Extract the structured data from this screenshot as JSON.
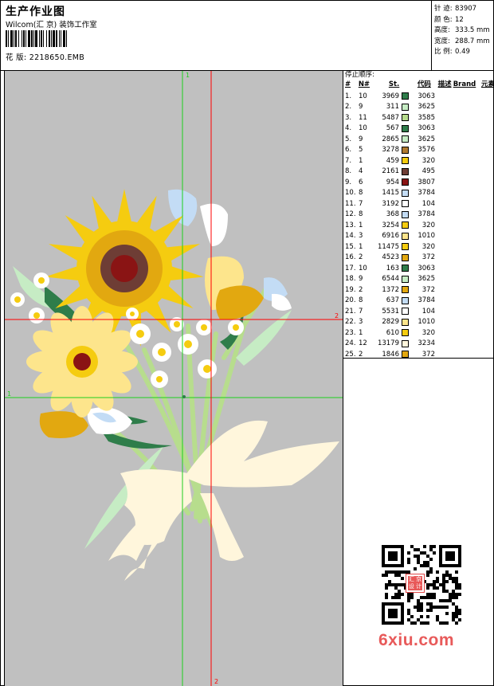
{
  "header": {
    "title": "生产作业图",
    "company": "Wilcom(汇 京) 装饰工作室",
    "design_label": "花 版: ",
    "design_file": "2218650.EMB"
  },
  "stats": [
    {
      "label": "针 迹:",
      "value": "83907"
    },
    {
      "label": "颜 色:",
      "value": "12"
    },
    {
      "label": "高度:",
      "value": "333.5 mm"
    },
    {
      "label": "宽度:",
      "value": "288.7 mm"
    },
    {
      "label": "比 例:",
      "value": "0.49"
    }
  ],
  "guides": {
    "red_vertical_label": "2",
    "red_horizontal_label": "2",
    "green_vertical_label": "1",
    "green_horizontal_label": "1"
  },
  "stop_sequence": {
    "title": "停止顺序:",
    "headers": {
      "idx": "#",
      "n": "N#",
      "st": "St.",
      "code": "代码",
      "desc": "描述",
      "brand": "Brand",
      "element": "元素"
    },
    "rows": [
      {
        "idx": "1.",
        "n": "10",
        "st": "3969",
        "code": "3063",
        "color": "#2f7d4a"
      },
      {
        "idx": "2.",
        "n": "9",
        "st": "311",
        "code": "3625",
        "color": "#c6ecc4"
      },
      {
        "idx": "3.",
        "n": "11",
        "st": "5487",
        "code": "3585",
        "color": "#b7dd8d"
      },
      {
        "idx": "4.",
        "n": "10",
        "st": "567",
        "code": "3063",
        "color": "#2f7d4a"
      },
      {
        "idx": "5.",
        "n": "9",
        "st": "2865",
        "code": "3625",
        "color": "#c6ecc4"
      },
      {
        "idx": "6.",
        "n": "5",
        "st": "3278",
        "code": "3576",
        "color": "#b07a30"
      },
      {
        "idx": "7.",
        "n": "1",
        "st": "459",
        "code": "320",
        "color": "#f5cc10"
      },
      {
        "idx": "8.",
        "n": "4",
        "st": "2161",
        "code": "495",
        "color": "#6e3d35"
      },
      {
        "idx": "9.",
        "n": "6",
        "st": "954",
        "code": "3807",
        "color": "#8a1414"
      },
      {
        "idx": "10.",
        "n": "8",
        "st": "1415",
        "code": "3784",
        "color": "#c3dcf5"
      },
      {
        "idx": "11.",
        "n": "7",
        "st": "3192",
        "code": "104",
        "color": "#ffffff"
      },
      {
        "idx": "12.",
        "n": "8",
        "st": "368",
        "code": "3784",
        "color": "#c3dcf5"
      },
      {
        "idx": "13.",
        "n": "1",
        "st": "3254",
        "code": "320",
        "color": "#f5cc10"
      },
      {
        "idx": "14.",
        "n": "3",
        "st": "6916",
        "code": "1010",
        "color": "#fde58c"
      },
      {
        "idx": "15.",
        "n": "1",
        "st": "11475",
        "code": "320",
        "color": "#f5cc10"
      },
      {
        "idx": "16.",
        "n": "2",
        "st": "4523",
        "code": "372",
        "color": "#e2a810"
      },
      {
        "idx": "17.",
        "n": "10",
        "st": "163",
        "code": "3063",
        "color": "#2f7d4a"
      },
      {
        "idx": "18.",
        "n": "9",
        "st": "6544",
        "code": "3625",
        "color": "#c6ecc4"
      },
      {
        "idx": "19.",
        "n": "2",
        "st": "1372",
        "code": "372",
        "color": "#e2a810"
      },
      {
        "idx": "20.",
        "n": "8",
        "st": "637",
        "code": "3784",
        "color": "#c3dcf5"
      },
      {
        "idx": "21.",
        "n": "7",
        "st": "5531",
        "code": "104",
        "color": "#ffffff"
      },
      {
        "idx": "22.",
        "n": "3",
        "st": "2829",
        "code": "1010",
        "color": "#fde58c"
      },
      {
        "idx": "23.",
        "n": "1",
        "st": "610",
        "code": "320",
        "color": "#f5cc10"
      },
      {
        "idx": "24.",
        "n": "12",
        "st": "13179",
        "code": "3234",
        "color": "#fff6dc"
      },
      {
        "idx": "25.",
        "n": "2",
        "st": "1846",
        "code": "372",
        "color": "#e2a810"
      }
    ]
  },
  "qr": {
    "badge": "汇 京 设 计",
    "website": "6xiu.com"
  }
}
